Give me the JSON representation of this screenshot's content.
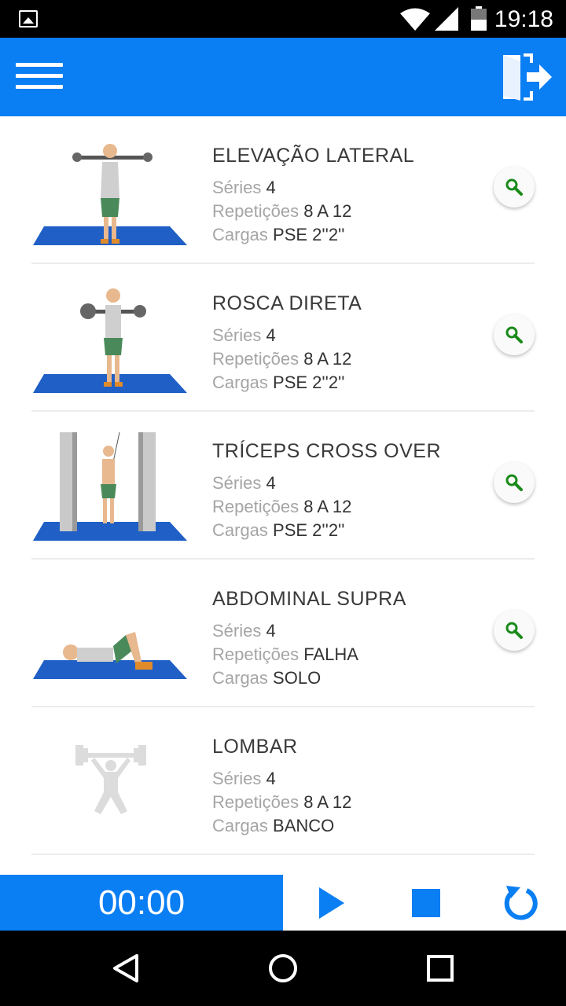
{
  "status_bar": {
    "time": "19:18",
    "icons": [
      "image-notification-icon",
      "wifi-icon",
      "signal-icon",
      "battery-icon"
    ]
  },
  "app_bar": {
    "icons": [
      "menu-icon",
      "exit-icon"
    ],
    "color": "#0a7ef3"
  },
  "exercises": [
    {
      "name": "ELEVAÇÃO LATERAL",
      "series_label": "Séries",
      "series": "4",
      "reps_label": "Repetições",
      "reps": "8 A 12",
      "load_label": "Cargas",
      "load": "PSE 2''2''",
      "has_details": true
    },
    {
      "name": "ROSCA DIRETA",
      "series_label": "Séries",
      "series": "4",
      "reps_label": "Repetições",
      "reps": "8 A 12",
      "load_label": "Cargas",
      "load": "PSE 2''2''",
      "has_details": true
    },
    {
      "name": "TRÍCEPS CROSS OVER",
      "series_label": "Séries",
      "series": "4",
      "reps_label": "Repetições",
      "reps": "8 A 12",
      "load_label": "Cargas",
      "load": "PSE 2''2''",
      "has_details": true
    },
    {
      "name": "ABDOMINAL SUPRA",
      "series_label": "Séries",
      "series": "4",
      "reps_label": "Repetições",
      "reps": "FALHA",
      "load_label": "Cargas",
      "load": "SOLO",
      "has_details": true
    },
    {
      "name": "LOMBAR",
      "series_label": "Séries",
      "series": "4",
      "reps_label": "Repetições",
      "reps": "8 A 12",
      "load_label": "Cargas",
      "load": "BANCO",
      "has_details": false
    }
  ],
  "timer": {
    "display": "00:00",
    "controls": [
      "play-icon",
      "stop-icon",
      "refresh-icon"
    ]
  },
  "nav_bar": {
    "icons": [
      "back-icon",
      "home-icon",
      "recents-icon"
    ]
  }
}
